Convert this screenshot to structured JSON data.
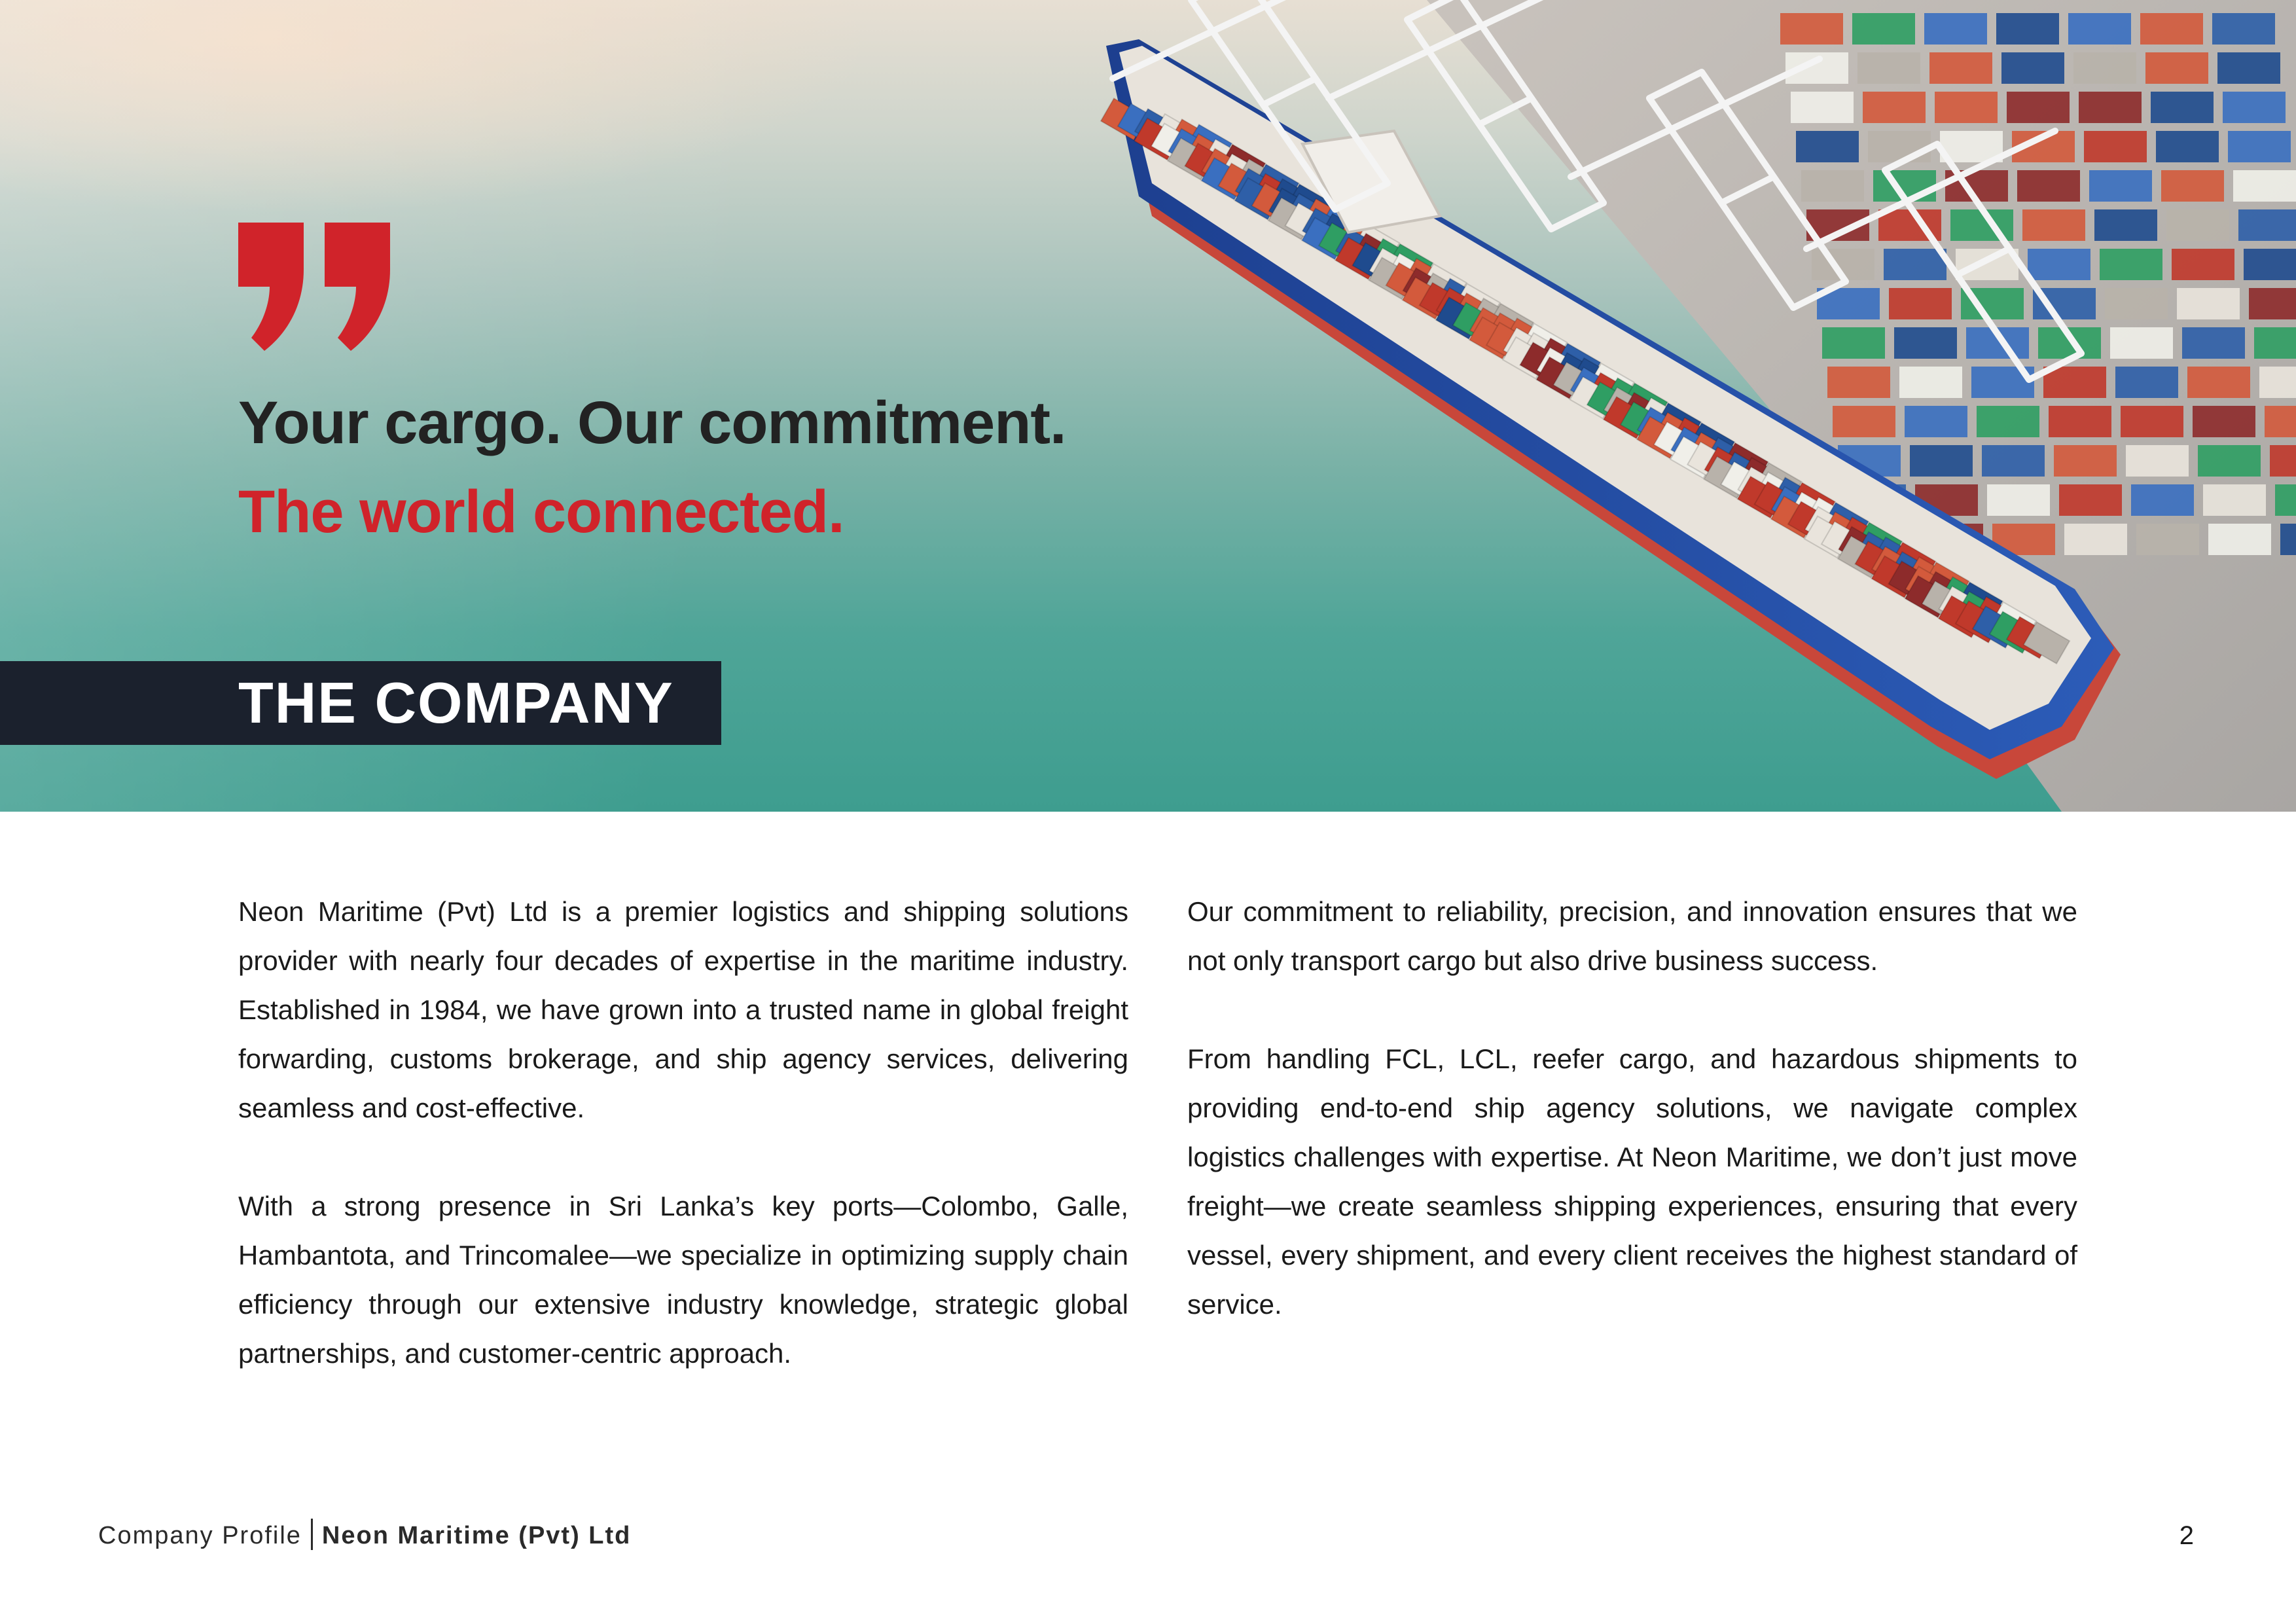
{
  "hero": {
    "tagline_primary": "Your cargo. Our commitment.",
    "tagline_accent": "The world connected.",
    "section_title": "THE COMPANY",
    "quote_icon": "closing-quote-icon",
    "image": "aerial-container-ship-port-image"
  },
  "body": {
    "left_paragraphs": [
      "Neon Maritime (Pvt) Ltd is a premier logistics and shipping solutions provider with nearly four decades of expertise in the maritime industry. Established in 1984, we have grown into a trusted name in global freight forwarding, customs brokerage, and ship agency services, delivering seamless and cost-effective.",
      "With a strong presence in Sri Lanka’s key ports—Colombo, Galle, Hambantota, and Trincomalee—we specialize in optimizing supply chain efficiency through our extensive industry knowledge, strategic global partnerships, and customer-centric approach."
    ],
    "right_paragraphs": [
      "Our commitment to reliability, precision, and innovation ensures that we not only transport cargo but also drive business success.",
      "From handling FCL, LCL, reefer cargo, and hazardous shipments to providing end-to-end ship agency solutions, we navigate complex logistics challenges with expertise. At Neon Maritime, we don’t just move freight—we create seamless shipping experiences, ensuring that every vessel, every shipment, and every client receives the highest standard of service."
    ]
  },
  "footer": {
    "label": "Company Profile",
    "company": "Neon Maritime (Pvt) Ltd",
    "page_number": "2"
  },
  "colors": {
    "accent_red": "#d0232a",
    "dark_band": "#1b212d",
    "heading_dark": "#222222"
  }
}
